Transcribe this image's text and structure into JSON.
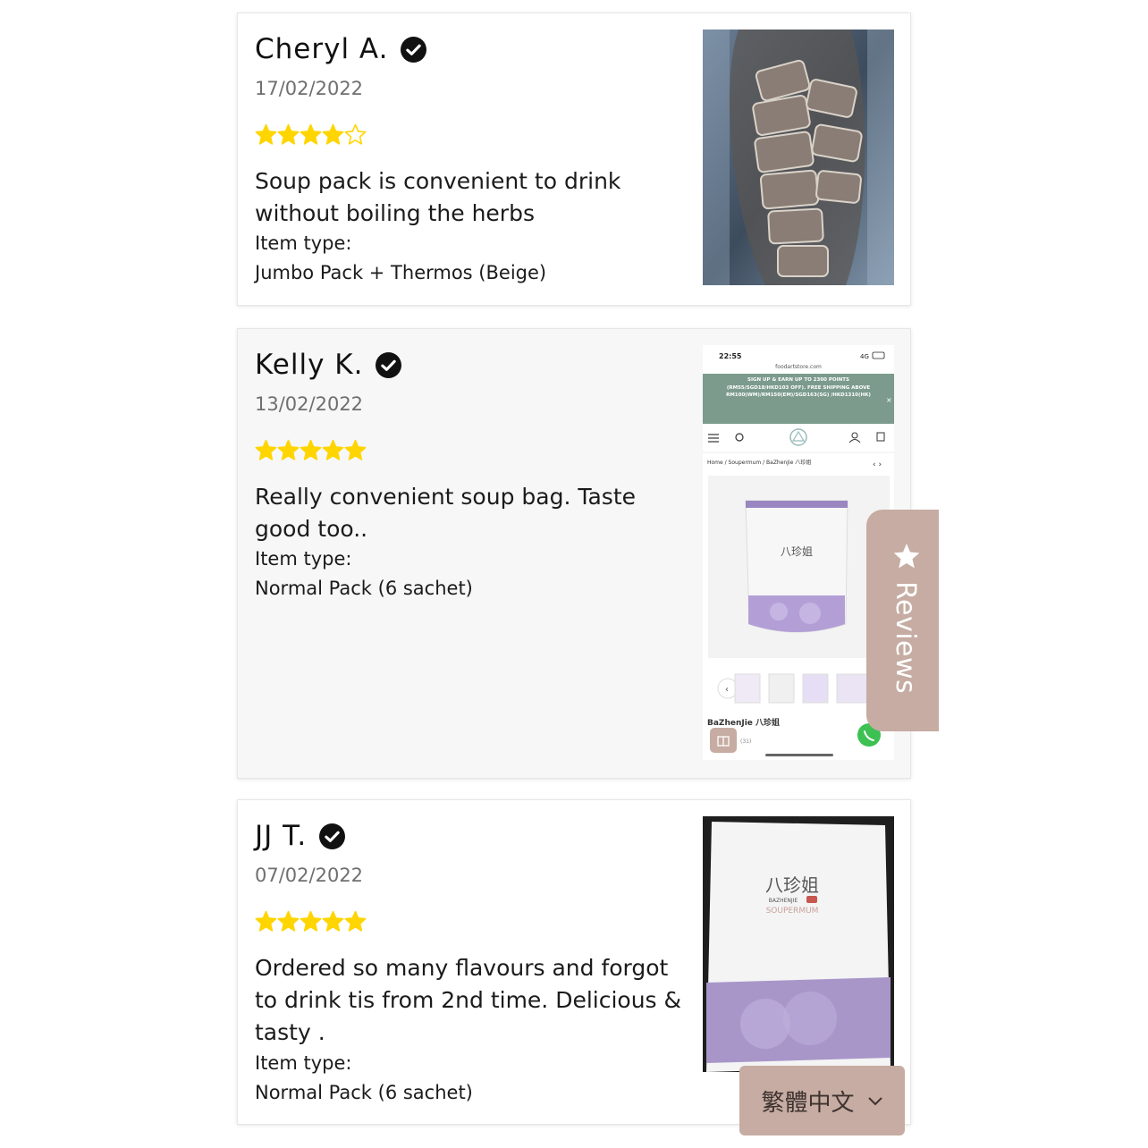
{
  "reviews": [
    {
      "name": "Cheryl A.",
      "date": "17/02/2022",
      "rating": 4,
      "text": "Soup pack is convenient to drink without boiling the herbs",
      "item_type_label": "Item type:",
      "item_type": "Jumbo Pack + Thermos (Beige)",
      "photo": "soup-bags-in-bag-photo"
    },
    {
      "name": "Kelly K.",
      "date": "13/02/2022",
      "rating": 5,
      "text": "Really convenient soup bag. Taste good too..",
      "item_type_label": "Item type:",
      "item_type": "Normal Pack (6 sachet)",
      "photo": {
        "kind": "phone-screenshot",
        "time": "22:55",
        "signal": "4G",
        "url": "foodartstore.com",
        "banner": "SIGN UP & EARN UP TO 2300 POINTS (RM55/SGD18/HKD103 OFF). FREE SHIPPING ABOVE RM100(WM)/RM150(EM)/SGD163(SG) /HKD1310(HK)",
        "breadcrumb": "Home / Soupermum / BaZhenJie 八珍姐",
        "product_name": "BaZhenJie 八珍姐",
        "review_count": "(31)",
        "package_label": "八珍姐"
      }
    },
    {
      "name": "JJ T.",
      "date": "07/02/2022",
      "rating": 5,
      "text": "Ordered so many flavours and forgot to drink tis from 2nd time. Delicious & tasty .",
      "item_type_label": "Item type:",
      "item_type": "Normal Pack (6 sachet)",
      "photo": {
        "kind": "package-photo",
        "brand_cn": "八珍姐",
        "brand_en": "BAZHENJIE",
        "maker": "SOUPERMUM"
      }
    }
  ],
  "reviews_tab": {
    "label": "Reviews",
    "icon": "star-icon"
  },
  "language_switch": {
    "label": "繁體中文",
    "icon": "chevron-down-icon"
  },
  "colors": {
    "star": "#ffd500",
    "accent": "#c6aca2",
    "verified": "#111111"
  }
}
